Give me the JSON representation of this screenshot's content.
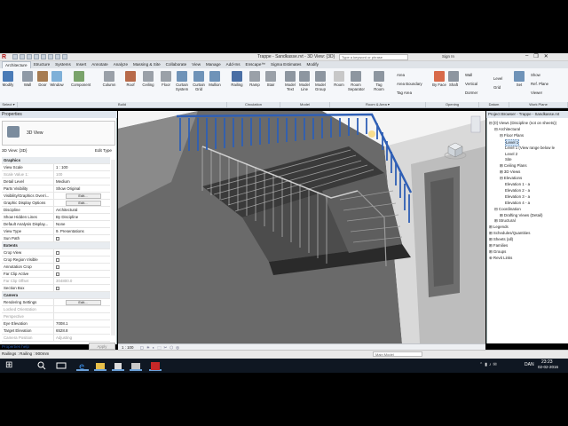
{
  "app": {
    "title": "Trappe - Sandkasse.rvt - 3D View: {3D}",
    "search_placeholder": "Type a keyword or phrase",
    "sign_in": "Sign In",
    "logo": "R",
    "window_controls": [
      "–",
      "❐",
      "✕"
    ]
  },
  "ribbon": {
    "tabs": [
      "Architecture",
      "Structure",
      "Systems",
      "Insert",
      "Annotate",
      "Analyze",
      "Massing & Site",
      "Collaborate",
      "View",
      "Manage",
      "Add-Ins",
      "Enscape™",
      "Sigma Estimates",
      "Modify"
    ],
    "active_tab": 0,
    "buttons": [
      {
        "label": "Modify",
        "icon": "cursor-icon",
        "color": "#4a7bb7"
      },
      {
        "label": "Wall",
        "icon": "wall-icon",
        "color": "#8f9aa6"
      },
      {
        "label": "Door",
        "icon": "door-icon",
        "color": "#a67c52"
      },
      {
        "label": "Window",
        "icon": "window-icon",
        "color": "#7fb0d8"
      },
      {
        "label": "Component",
        "icon": "component-icon",
        "color": "#7aa36b"
      },
      {
        "label": "Column",
        "icon": "column-icon",
        "color": "#9aa0a8"
      },
      {
        "label": "Roof",
        "icon": "roof-icon",
        "color": "#b76a4a"
      },
      {
        "label": "Ceiling",
        "icon": "ceiling-icon",
        "color": "#9aa0a8"
      },
      {
        "label": "Floor",
        "icon": "floor-icon",
        "color": "#9aa0a8"
      },
      {
        "label": "Curtain System",
        "icon": "curtain-system-icon",
        "color": "#6f93b8"
      },
      {
        "label": "Curtain Grid",
        "icon": "curtain-grid-icon",
        "color": "#6f93b8"
      },
      {
        "label": "Mullion",
        "icon": "mullion-icon",
        "color": "#6f93b8"
      },
      {
        "label": "Railing",
        "icon": "railing-icon",
        "color": "#4a6fa5"
      },
      {
        "label": "Ramp",
        "icon": "ramp-icon",
        "color": "#9aa0a8"
      },
      {
        "label": "Stair",
        "icon": "stair-icon",
        "color": "#9aa0a8"
      },
      {
        "label": "Model Text",
        "icon": "model-text-icon",
        "color": "#8d96a0"
      },
      {
        "label": "Model Line",
        "icon": "model-line-icon",
        "color": "#8d96a0"
      },
      {
        "label": "Model Group",
        "icon": "model-group-icon",
        "color": "#8d96a0"
      },
      {
        "label": "Room",
        "icon": "room-icon",
        "color": "#c8c8c8"
      },
      {
        "label": "Room Separator",
        "icon": "room-separator-icon",
        "color": "#8d96a0"
      },
      {
        "label": "Tag Room",
        "icon": "tag-room-icon",
        "color": "#8d96a0"
      },
      {
        "label": "By Face",
        "icon": "by-face-icon",
        "color": "#d86a4a"
      },
      {
        "label": "Shaft",
        "icon": "shaft-icon",
        "color": "#8d96a0"
      },
      {
        "label": "Set",
        "icon": "set-icon",
        "color": "#6f93b8"
      }
    ],
    "small_buttons": [
      "Area",
      "Area Boundary",
      "Tag Area",
      "Wall",
      "Vertical",
      "Dormer",
      "Level",
      "Grid",
      "Show",
      "Ref. Plane",
      "Viewer"
    ],
    "panels": [
      "Select ▾",
      "Build",
      "Circulation",
      "Model",
      "Room & Area ▾",
      "Opening",
      "Datum",
      "Work Plane"
    ]
  },
  "properties": {
    "title": "Properties",
    "type_name": "3D View",
    "instance_selector": "3D View: {3D}",
    "edit_type": "Edit Type",
    "rows": [
      {
        "k": "Graphics",
        "v": "",
        "kind": "group"
      },
      {
        "k": "View Scale",
        "v": "1 : 100",
        "kind": "row"
      },
      {
        "k": "Scale Value    1:",
        "v": "100",
        "kind": "gray"
      },
      {
        "k": "Detail Level",
        "v": "Medium",
        "kind": "row"
      },
      {
        "k": "Parts Visibility",
        "v": "Show Original",
        "kind": "row"
      },
      {
        "k": "Visibility/Graphics Overri...",
        "v": "Edit...",
        "kind": "button"
      },
      {
        "k": "Graphic Display Options",
        "v": "Edit...",
        "kind": "button"
      },
      {
        "k": "Discipline",
        "v": "Architectural",
        "kind": "row"
      },
      {
        "k": "Show Hidden Lines",
        "v": "By Discipline",
        "kind": "row"
      },
      {
        "k": "Default Analysis Display...",
        "v": "None",
        "kind": "row"
      },
      {
        "k": "View Type",
        "v": "9. Presentations",
        "kind": "row"
      },
      {
        "k": "Sun Path",
        "v": "",
        "kind": "check"
      },
      {
        "k": "Extents",
        "v": "",
        "kind": "group"
      },
      {
        "k": "Crop View",
        "v": "",
        "kind": "check"
      },
      {
        "k": "Crop Region Visible",
        "v": "",
        "kind": "check"
      },
      {
        "k": "Annotation Crop",
        "v": "",
        "kind": "check"
      },
      {
        "k": "Far Clip Active",
        "v": "",
        "kind": "check"
      },
      {
        "k": "Far Clip Offset",
        "v": "304800.0",
        "kind": "gray"
      },
      {
        "k": "Section Box",
        "v": "",
        "kind": "check"
      },
      {
        "k": "Camera",
        "v": "",
        "kind": "group"
      },
      {
        "k": "Rendering Settings",
        "v": "Edit...",
        "kind": "button"
      },
      {
        "k": "Locked Orientation",
        "v": "",
        "kind": "gray"
      },
      {
        "k": "Perspective",
        "v": "",
        "kind": "gray"
      },
      {
        "k": "Eye Elevation",
        "v": "7008.1",
        "kind": "row"
      },
      {
        "k": "Target Elevation",
        "v": "6528.8",
        "kind": "row"
      },
      {
        "k": "Camera Position",
        "v": "Adjusting",
        "kind": "gray"
      }
    ],
    "help": "Properties help",
    "apply": "Apply"
  },
  "view_bar": {
    "scale": "1 : 100"
  },
  "browser": {
    "title": "Project Browser - Trappe - Sandkasse.rvt",
    "nodes": [
      {
        "t": "⊟ [0] Views (Discipline (not on sheets))",
        "lvl": 0
      },
      {
        "t": "⊟ Architectural",
        "lvl": 1
      },
      {
        "t": "⊟ Floor Plans",
        "lvl": 2
      },
      {
        "t": "Level 1",
        "lvl": 3,
        "sel": true
      },
      {
        "t": "Level 1 (View range below le",
        "lvl": 3
      },
      {
        "t": "Level 2",
        "lvl": 3
      },
      {
        "t": "Site",
        "lvl": 3
      },
      {
        "t": "⊞ Ceiling Plans",
        "lvl": 2
      },
      {
        "t": "⊞ 3D Views",
        "lvl": 2
      },
      {
        "t": "⊟ Elevations",
        "lvl": 2
      },
      {
        "t": "Elevation 1 - a",
        "lvl": 3
      },
      {
        "t": "Elevation 2 - a",
        "lvl": 3
      },
      {
        "t": "Elevation 3 - a",
        "lvl": 3
      },
      {
        "t": "Elevation 4 - a",
        "lvl": 3
      },
      {
        "t": "⊟ Coordination",
        "lvl": 1
      },
      {
        "t": "⊞ Drafting Views (Detail)",
        "lvl": 2
      },
      {
        "t": "⊞ Structural",
        "lvl": 1
      },
      {
        "t": "⊞ Legends",
        "lvl": 0
      },
      {
        "t": "⊞ Schedules/Quantities",
        "lvl": 0
      },
      {
        "t": "⊞ Sheets (all)",
        "lvl": 0
      },
      {
        "t": "⊞ Families",
        "lvl": 0
      },
      {
        "t": "⊞ Groups",
        "lvl": 0
      },
      {
        "t": "⊛ Revit Links",
        "lvl": 0
      }
    ]
  },
  "status": {
    "text": "Railings : Railing : 900mm",
    "workset": "Main Model"
  },
  "taskbar": {
    "lang": "DAN",
    "time": "23:23",
    "date": "02-02-2016"
  },
  "colors": {
    "railing": "#2f5fb5",
    "accent": "#2a5db0"
  }
}
